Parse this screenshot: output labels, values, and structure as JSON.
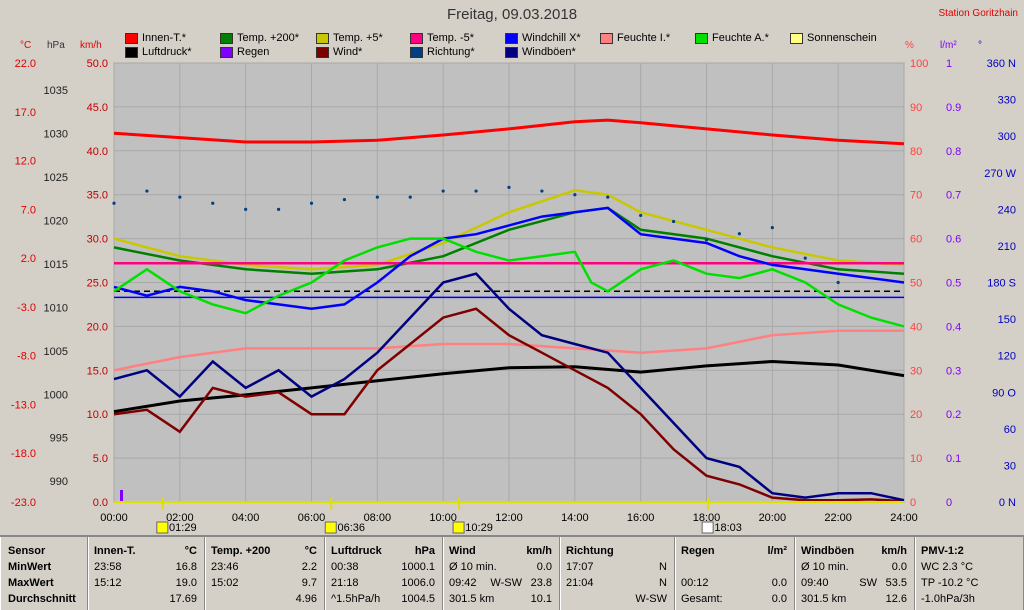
{
  "title": "Freitag, 09.03.2018",
  "station": "Station Goritzhain",
  "legend": [
    {
      "label": "Innen-T.*",
      "color": "#ff0000"
    },
    {
      "label": "Temp. +200*",
      "color": "#008000"
    },
    {
      "label": "Temp. +5*",
      "color": "#c8c800"
    },
    {
      "label": "Temp. -5*",
      "color": "#ff0080"
    },
    {
      "label": "Windchill X*",
      "color": "#0000ff"
    },
    {
      "label": "Feuchte I.*",
      "color": "#ff8080"
    },
    {
      "label": "Feuchte A.*",
      "color": "#00e000"
    },
    {
      "label": "Sonnenschein",
      "color": "#ffff80"
    },
    {
      "label": "Luftdruck*",
      "color": "#000000"
    },
    {
      "label": "Regen",
      "color": "#8000ff"
    },
    {
      "label": "Wind*",
      "color": "#800000"
    },
    {
      "label": "Richtung*",
      "color": "#004080"
    },
    {
      "label": "Windböen*",
      "color": "#000080"
    }
  ],
  "unit_labels": {
    "c": "°C",
    "hpa": "hPa",
    "kmh": "km/h",
    "pct": "%",
    "lm2": "l/m²",
    "deg": "°"
  },
  "axes": {
    "celsius": [
      "22.0",
      "17.0",
      "12.0",
      "7.0",
      "2.0",
      "-3.0",
      "-8.0",
      "-13.0",
      "-18.0",
      "-23.0"
    ],
    "hpa": [
      "1035",
      "1030",
      "1025",
      "1020",
      "1015",
      "1010",
      "1005",
      "1000",
      "995",
      "990"
    ],
    "kmh": [
      "50.0",
      "45.0",
      "40.0",
      "35.0",
      "30.0",
      "25.0",
      "20.0",
      "15.0",
      "10.0",
      "5.0",
      "0.0"
    ],
    "pct": [
      "100",
      "90",
      "80",
      "70",
      "60",
      "50",
      "40",
      "30",
      "20",
      "10",
      "0"
    ],
    "lm2": [
      "1",
      "0.9",
      "0.8",
      "0.7",
      "0.6",
      "0.5",
      "0.4",
      "0.3",
      "0.2",
      "0.1",
      "0"
    ],
    "deg": [
      "360 N",
      "330",
      "300",
      "270 W",
      "240",
      "210",
      "180 S",
      "150",
      "120",
      "90 O",
      "60",
      "30",
      "0 N"
    ],
    "hours": [
      "00:00",
      "02:00",
      "04:00",
      "06:00",
      "08:00",
      "10:00",
      "12:00",
      "14:00",
      "16:00",
      "18:00",
      "20:00",
      "22:00",
      "24:00"
    ]
  },
  "sun_events": {
    "moonrise": "01:29",
    "sunrise": "06:36",
    "moonset": "10:29",
    "sunset": "18:03"
  },
  "chart_data": {
    "type": "line",
    "title": "Freitag, 09.03.2018",
    "x_unit": "hour",
    "series": [
      {
        "name": "Innen-T.*",
        "axis": "km/h-scale",
        "color": "#ff0000",
        "x": [
          0,
          2,
          4,
          6,
          8,
          10,
          12,
          14,
          15,
          16,
          18,
          20,
          22,
          24
        ],
        "values": [
          42,
          41.5,
          41,
          41,
          41.2,
          41.8,
          42.5,
          43.3,
          43.5,
          43.2,
          42.5,
          41.8,
          41.2,
          40.8
        ]
      },
      {
        "name": "Temp. +200*",
        "axis": "km/h-scale",
        "color": "#008000",
        "x": [
          0,
          2,
          4,
          6,
          8,
          10,
          12,
          14,
          15,
          16,
          18,
          20,
          22,
          24
        ],
        "values": [
          29,
          27.5,
          26.5,
          26,
          26.5,
          28,
          31,
          33,
          33.5,
          31,
          30,
          28,
          26.5,
          26
        ]
      },
      {
        "name": "Temp. +5*",
        "axis": "km/h-scale",
        "color": "#c8c800",
        "x": [
          0,
          2,
          4,
          6,
          8,
          10,
          12,
          14,
          15,
          16,
          18,
          20,
          22,
          24
        ],
        "values": [
          30,
          28,
          27,
          26.5,
          27,
          29.5,
          33,
          35.5,
          35,
          33,
          31,
          29,
          27.5,
          27
        ]
      },
      {
        "name": "Temp. -5*",
        "axis": "km/h-scale",
        "color": "#ff0080",
        "x": [
          0,
          24
        ],
        "values": [
          27.2,
          27.2
        ]
      },
      {
        "name": "Windchill X*",
        "axis": "km/h-scale",
        "color": "#0000ff",
        "x": [
          0,
          1,
          2,
          3,
          4,
          5,
          6,
          7,
          8,
          9,
          10,
          11,
          12,
          13,
          14,
          15,
          16,
          17,
          18,
          19,
          20,
          21,
          22,
          23,
          24
        ],
        "values": [
          24.5,
          23.5,
          24.5,
          24,
          23,
          22.5,
          22,
          22.5,
          25,
          28,
          30,
          30.5,
          31.5,
          32.5,
          33,
          33.5,
          30.5,
          30,
          29.5,
          28,
          27,
          26.5,
          26,
          25.5,
          25
        ]
      },
      {
        "name": "Feuchte I.*",
        "axis": "pct",
        "color": "#ff8080",
        "x": [
          0,
          2,
          4,
          6,
          8,
          10,
          12,
          14,
          16,
          18,
          20,
          22,
          24
        ],
        "values": [
          30,
          33,
          35,
          35,
          35,
          36,
          36,
          35,
          34,
          35,
          38,
          39,
          39
        ]
      },
      {
        "name": "Feuchte A.*",
        "axis": "pct",
        "color": "#00e000",
        "x": [
          0,
          1,
          2,
          3,
          4,
          5,
          6,
          7,
          8,
          9,
          10,
          11,
          12,
          13,
          14,
          14.5,
          15,
          16,
          17,
          18,
          19,
          20,
          21,
          22,
          23,
          24
        ],
        "values": [
          48,
          53,
          48,
          45,
          43,
          47,
          50,
          55,
          58,
          60,
          60,
          57,
          55,
          56,
          57,
          50,
          48,
          53,
          55,
          52,
          51,
          53,
          50,
          45,
          42,
          40
        ]
      },
      {
        "name": "Luftdruck*",
        "axis": "hpa",
        "color": "#000000",
        "x": [
          0,
          2,
          4,
          6,
          8,
          10,
          12,
          14,
          16,
          18,
          20,
          22,
          24
        ],
        "values": [
          1000.3,
          1001.5,
          1002.2,
          1003,
          1003.8,
          1004.6,
          1005.3,
          1005.4,
          1004.8,
          1005.5,
          1006,
          1005.6,
          1004.4
        ]
      },
      {
        "name": "Wind*",
        "axis": "km/h",
        "color": "#800000",
        "x": [
          0,
          1,
          2,
          3,
          4,
          5,
          6,
          7,
          8,
          9,
          10,
          11,
          12,
          13,
          14,
          15,
          16,
          17,
          18,
          19,
          20,
          21,
          22,
          23,
          24
        ],
        "values": [
          10,
          10.5,
          8,
          13,
          12,
          12.5,
          10,
          10,
          15,
          18,
          21,
          22,
          19,
          17,
          15,
          13,
          10,
          6,
          3,
          2,
          0.5,
          0.2,
          0.2,
          0.3,
          0.1
        ]
      },
      {
        "name": "Windböen*",
        "axis": "km/h",
        "color": "#000080",
        "x": [
          0,
          1,
          2,
          3,
          4,
          5,
          6,
          7,
          8,
          9,
          10,
          11,
          12,
          13,
          14,
          15,
          16,
          17,
          18,
          19,
          20,
          21,
          22,
          23,
          24
        ],
        "values": [
          14,
          15,
          12,
          16,
          13,
          15,
          12,
          14,
          17,
          21,
          25,
          26,
          22,
          19,
          18,
          17,
          13,
          9,
          5,
          4,
          1,
          0.5,
          1,
          1,
          0.2
        ]
      },
      {
        "name": "Richtung*",
        "axis": "deg",
        "type": "scatter",
        "color": "#004080",
        "x": [
          0,
          1,
          2,
          3,
          4,
          5,
          6,
          7,
          8,
          9,
          10,
          11,
          12,
          13,
          14,
          15,
          16,
          17,
          18,
          19,
          20,
          21,
          22
        ],
        "values": [
          245,
          255,
          250,
          245,
          240,
          240,
          245,
          248,
          250,
          250,
          255,
          255,
          258,
          255,
          252,
          250,
          235,
          230,
          215,
          220,
          225,
          200,
          180
        ]
      }
    ],
    "reference_lines": [
      {
        "value": 24,
        "axis": "km/h-scale",
        "style": "dashed",
        "color": "#000000"
      },
      {
        "value": 23.3,
        "axis": "km/h-scale",
        "color": "#0000ff"
      }
    ],
    "ylim": [
      0,
      50
    ]
  },
  "table": {
    "rows": [
      "Sensor",
      "MinWert",
      "MaxWert",
      "Durchschnitt"
    ],
    "columns": [
      {
        "name": "Innen-T.",
        "unit": "°C",
        "min_time": "23:58",
        "min": "16.8",
        "max_time": "15:12",
        "max": "19.0",
        "avg": "17.69"
      },
      {
        "name": "Temp. +200",
        "unit": "°C",
        "min_time": "23:46",
        "min": "2.2",
        "max_time": "15:02",
        "max": "9.7",
        "avg": "4.96"
      },
      {
        "name": "Luftdruck",
        "unit": "hPa",
        "min_time": "00:38",
        "min": "1000.1",
        "max_time": "21:18",
        "max": "1006.0",
        "avg_time": "^1.5hPa/h",
        "avg": "1004.5"
      },
      {
        "name": "Wind",
        "unit": "km/h",
        "min_time": "Ø 10 min.",
        "min": "0.0",
        "max_time": "09:42",
        "max_dir": "W-SW",
        "max": "23.8",
        "avg_time": "301.5 km",
        "avg": "10.1"
      },
      {
        "name": "Richtung",
        "unit": "",
        "min_time": "17:07",
        "min": "N",
        "max_time": "21:04",
        "max": "N",
        "avg": "W-SW"
      },
      {
        "name": "Regen",
        "unit": "l/m²",
        "min_time": "",
        "min": "",
        "max_time": "00:12",
        "max": "0.0",
        "avg_time": "Gesamt:",
        "avg": "0.0"
      },
      {
        "name": "Windböen",
        "unit": "km/h",
        "min_time": "Ø 10 min.",
        "min": "0.0",
        "max_time": "09:40",
        "max_dir": "SW",
        "max": "53.5",
        "avg_time": "301.5 km",
        "avg": "12.6"
      },
      {
        "name": "PMV-1:2",
        "unit": "",
        "min_time": "WC 2.3 °C",
        "max_time": "TP -10.2 °C",
        "avg_time": "-1.0hPa/3h"
      }
    ]
  }
}
